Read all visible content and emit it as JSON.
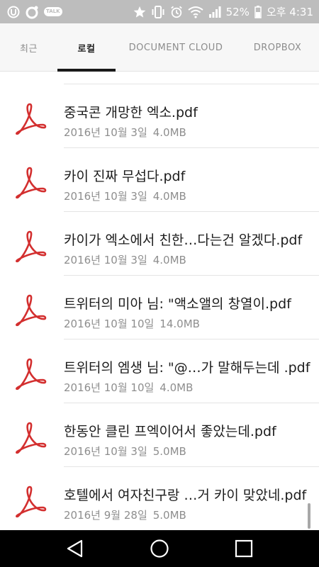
{
  "status_bar": {
    "talk_label": "TALK",
    "battery": "52%",
    "time": "오후 4:31"
  },
  "tabs": [
    {
      "label": "최근",
      "active": false
    },
    {
      "label": "로컬",
      "active": true
    },
    {
      "label": "DOCUMENT CLOUD",
      "active": false
    },
    {
      "label": "DROPBOX",
      "active": false
    }
  ],
  "files": [
    {
      "name": "중국콘 개망한 엑소.pdf",
      "date": "2016년 10월 3일",
      "size": "4.0MB"
    },
    {
      "name": "카이 진짜 무섭다.pdf",
      "date": "2016년 10월 3일",
      "size": "4.0MB"
    },
    {
      "name": "카이가 엑소에서 친한…다는건 알겠다.pdf",
      "date": "2016년 10월 3일",
      "size": "4.0MB"
    },
    {
      "name": "트위터의 미아 님: \"액소앨의 창열이.pdf",
      "date": "2016년 10월 10일",
      "size": "14.0MB"
    },
    {
      "name": "트위터의 엠생 님: \"@…가 말해두는데 .pdf",
      "date": "2016년 10월 10일",
      "size": "4.0MB"
    },
    {
      "name": "한동안 클린 프엑이어서 좋았는데.pdf",
      "date": "2016년 10월 3일",
      "size": "5.0MB"
    },
    {
      "name": "호텔에서 여자친구랑 …거 카이 맞았네.pdf",
      "date": "2016년 9월 28일",
      "size": "5.0MB"
    }
  ],
  "colors": {
    "pdf_icon": "#d32f2f",
    "status_bar_bg": "#bdbdbd",
    "tab_bar_bg": "#f7f7f7",
    "nav_bar_bg": "#000000"
  },
  "icons": {
    "status_left": [
      "u-plus-icon",
      "kakao-icon",
      "kakaotalk-icon"
    ],
    "status_right": [
      "star-icon",
      "vibrate-icon",
      "alarm-icon",
      "wifi-icon",
      "signal-icon",
      "battery-icon"
    ],
    "file": "adobe-pdf-icon",
    "nav": [
      "back-icon",
      "home-icon",
      "recents-icon"
    ]
  }
}
